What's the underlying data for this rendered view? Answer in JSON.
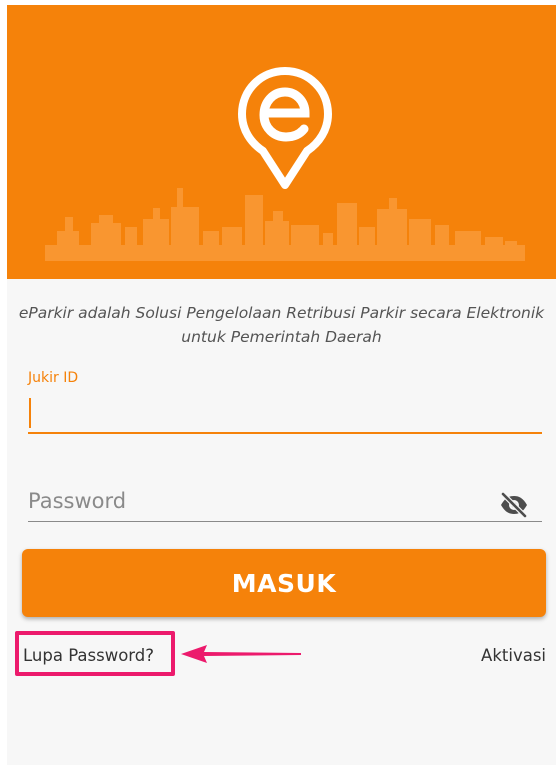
{
  "app": {
    "logo_letter": "e"
  },
  "colors": {
    "brand": "#f5820a",
    "annotation": "#ec1a6c"
  },
  "tagline": "eParkir adalah Solusi Pengelolaan Retribusi Parkir secara Elektronik untuk Pemerintah Daerah",
  "form": {
    "jukir_label": "Jukir ID",
    "jukir_value": "",
    "password_placeholder": "Password",
    "password_value": "",
    "toggle_icon": "eye-off-icon"
  },
  "actions": {
    "submit_label": "MASUK",
    "forgot_label": "Lupa Password?",
    "activate_label": "Aktivasi"
  }
}
